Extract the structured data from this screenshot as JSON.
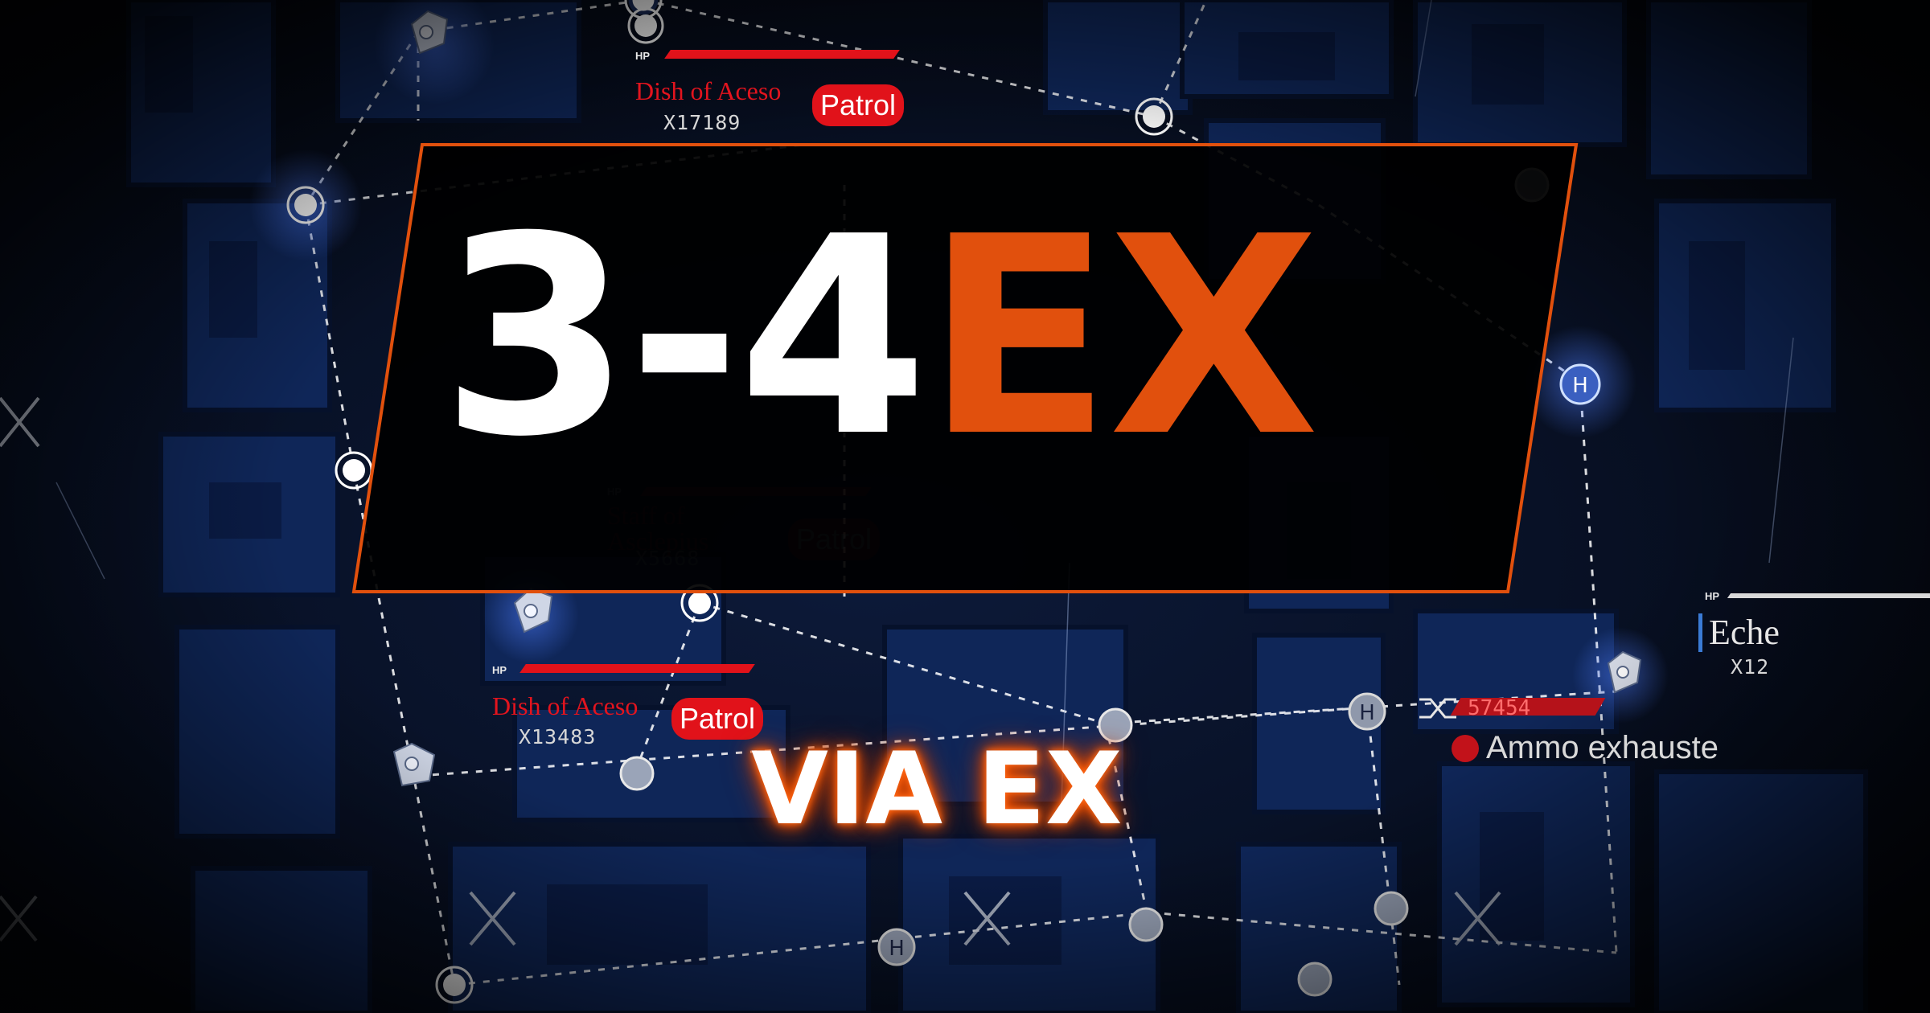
{
  "title": {
    "main": "3-4",
    "accent": "EX"
  },
  "subtitle": "VIA EX",
  "colors": {
    "accent": "#e1500d",
    "enemy_red": "#e1121a",
    "map_blue": "#0f2a66",
    "node_white": "#ffffff",
    "echelon_blue": "#3a7bd5"
  },
  "enemies": [
    {
      "hp_label": "HP",
      "name": "Dish of Aceso",
      "count": "X17189",
      "badge": "Patrol"
    },
    {
      "hp_label": "HP",
      "name": "Staff of Asclepius",
      "count": "X5668",
      "badge": "Patrol"
    },
    {
      "hp_label": "HP",
      "name": "Dish of Aceso",
      "count": "X13483",
      "badge": "Patrol"
    }
  ],
  "echelon": {
    "hp_label": "HP",
    "name": "Eche",
    "count": "X12"
  },
  "status": {
    "count": "57454",
    "message": "Ammo exhauste"
  },
  "icons": [
    "map-node-icon",
    "enemy-unit-icon",
    "heliport-icon",
    "cross-marker-icon",
    "shuffle-icon",
    "ally-unit-icon"
  ]
}
